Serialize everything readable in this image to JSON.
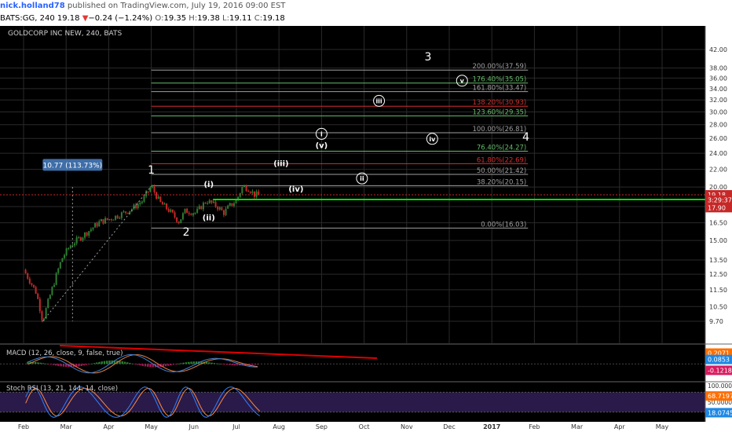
{
  "header": {
    "user": "nick.holland78",
    "published": "published on TradingView.com, July 19, 2016 09:00 EST",
    "symbol": "BATS:GG, 240",
    "last": "19.18",
    "change_arrow": "▼",
    "change": "−0.24 (−1.24%)",
    "open_label": "O:",
    "open": "19.35",
    "high_label": "H:",
    "high": "19.38",
    "low_label": "L:",
    "low": "19.11",
    "close_label": "C:",
    "close": "19.18"
  },
  "chart_title": "GOLDCORP INC NEW, 240, BATS",
  "colors": {
    "background": "#000000",
    "up_candle": "#2e7d32",
    "down_candle": "#c62828",
    "grid": "#2a2a2a",
    "green_line": "#00e000",
    "red_trendline": "#e00000",
    "macd_line": "#3f7fd0",
    "signal_line": "#e08040",
    "stoch_k": "#2f80ff",
    "stoch_d": "#ff8a3d",
    "stoch_band": "#2a1a4a"
  },
  "chart_data": {
    "type": "candlestick",
    "title": "GOLDCORP INC NEW, 240, BATS",
    "x_tick_labels": [
      "Feb",
      "Mar",
      "Apr",
      "May",
      "Jun",
      "Jul",
      "Aug",
      "Sep",
      "Oct",
      "Nov",
      "Dec",
      "2017",
      "Feb",
      "Mar",
      "Apr",
      "May"
    ],
    "price_axis": {
      "ylim": [
        9.0,
        42.5
      ],
      "scale": "log",
      "tick_labels": [
        9.7,
        10.5,
        11.5,
        12.5,
        13.5,
        15.0,
        16.5,
        18.0,
        20.0,
        22.0,
        24.0,
        26.0,
        28.0,
        30.0,
        32.0,
        34.0,
        36.0,
        38.0,
        42.0
      ]
    },
    "price_path_months": [
      [
        0.0,
        12.8
      ],
      [
        0.3,
        11.3
      ],
      [
        0.45,
        9.7
      ],
      [
        0.7,
        11.8
      ],
      [
        0.9,
        13.6
      ],
      [
        1.1,
        14.6
      ],
      [
        1.4,
        15.4
      ],
      [
        1.6,
        16.0
      ],
      [
        1.8,
        16.6
      ],
      [
        2.0,
        16.8
      ],
      [
        2.3,
        17.3
      ],
      [
        2.55,
        17.8
      ],
      [
        2.8,
        18.6
      ],
      [
        3.0,
        20.1
      ],
      [
        3.2,
        18.4
      ],
      [
        3.4,
        17.7
      ],
      [
        3.65,
        16.6
      ],
      [
        3.8,
        17.6
      ],
      [
        4.05,
        17.4
      ],
      [
        4.3,
        18.6
      ],
      [
        4.55,
        18.0
      ],
      [
        4.7,
        17.4
      ],
      [
        4.85,
        18.1
      ],
      [
        5.0,
        18.6
      ],
      [
        5.15,
        20.1
      ],
      [
        5.3,
        19.8
      ],
      [
        5.42,
        19.2
      ],
      [
        5.55,
        19.2
      ]
    ],
    "last_price": 19.18,
    "price_labels": [
      {
        "text": "19.18",
        "value": 19.18,
        "color": "#c62828"
      },
      {
        "text": "3:29:37",
        "value": 18.65,
        "color": "#c62828"
      },
      {
        "text": "17.90",
        "value": 17.9,
        "color": "#c62828"
      }
    ],
    "fib_levels": [
      {
        "label": "200.00%(37.59)",
        "value": 37.59,
        "color": "#9e9e9e"
      },
      {
        "label": "176.40%(35.05)",
        "value": 35.05,
        "color": "#66bb6a"
      },
      {
        "label": "161.80%(33.47)",
        "value": 33.47,
        "color": "#9e9e9e"
      },
      {
        "label": "138.20%(30.93)",
        "value": 30.93,
        "color": "#d32f2f"
      },
      {
        "label": "123.60%(29.35)",
        "value": 29.35,
        "color": "#66bb6a"
      },
      {
        "label": "100.00%(26.81)",
        "value": 26.81,
        "color": "#9e9e9e"
      },
      {
        "label": "76.40%(24.27)",
        "value": 24.27,
        "color": "#66bb6a"
      },
      {
        "label": "61.80%(22.69)",
        "value": 22.69,
        "color": "#d32f2f"
      },
      {
        "label": "50.00%(21.42)",
        "value": 21.42,
        "color": "#9e9e9e"
      },
      {
        "label": "38.20%(20.15)",
        "value": 20.15,
        "color": "#9e9e9e"
      },
      {
        "label": "0.00%(16.03)",
        "value": 16.03,
        "color": "#9e9e9e"
      }
    ],
    "green_line_value": 18.7,
    "measure_label": "10.77 (113.73%)",
    "wave_labels": [
      {
        "text": "1",
        "month": 3.0,
        "value": 21.5,
        "style": "plain"
      },
      {
        "text": "2",
        "month": 3.82,
        "value": 15.4,
        "style": "plain"
      },
      {
        "text": "3",
        "month": 9.5,
        "value": 39.6,
        "style": "plain"
      },
      {
        "text": "4",
        "month": 11.8,
        "value": 25.7,
        "style": "plain"
      },
      {
        "text": "(i)",
        "month": 4.35,
        "value": 20.0,
        "style": "paren"
      },
      {
        "text": "(ii)",
        "month": 4.35,
        "value": 16.7,
        "style": "paren"
      },
      {
        "text": "(iii)",
        "month": 6.05,
        "value": 22.4,
        "style": "paren"
      },
      {
        "text": "(iv)",
        "month": 6.4,
        "value": 19.5,
        "style": "paren"
      },
      {
        "text": "(v)",
        "month": 7.0,
        "value": 24.7,
        "style": "paren"
      },
      {
        "text": "i",
        "month": 7.0,
        "value": 26.2,
        "style": "circle"
      },
      {
        "text": "ii",
        "month": 7.95,
        "value": 20.6,
        "style": "circle"
      },
      {
        "text": "iii",
        "month": 8.35,
        "value": 31.3,
        "style": "circle"
      },
      {
        "text": "iv",
        "month": 9.6,
        "value": 25.5,
        "style": "circle"
      },
      {
        "text": "v",
        "month": 10.3,
        "value": 34.9,
        "style": "circle"
      }
    ],
    "macd": {
      "label": "MACD (12, 26, close, 9, false, true)",
      "values": [
        {
          "text": "0.2071",
          "value": 0.2071,
          "color": "#ff6f00"
        },
        {
          "text": "0.0853",
          "value": 0.0853,
          "color": "#1e88e5"
        },
        {
          "text": "-0.1218",
          "value": -0.1218,
          "color": "#d81b60"
        }
      ],
      "ylim": [
        -0.25,
        0.32
      ]
    },
    "stoch_rsi": {
      "label": "Stoch RSI (13, 21, 144, 14, close)",
      "axis_labels": [
        {
          "text": "100.0000",
          "value": 100
        },
        {
          "text": "50.0000",
          "value": 50
        }
      ],
      "values": [
        {
          "text": "68.7197",
          "value": 68.7197,
          "color": "#ff6f00"
        },
        {
          "text": "18.0745",
          "value": 18.0745,
          "color": "#1e88e5"
        }
      ],
      "band": [
        20,
        80
      ]
    }
  }
}
